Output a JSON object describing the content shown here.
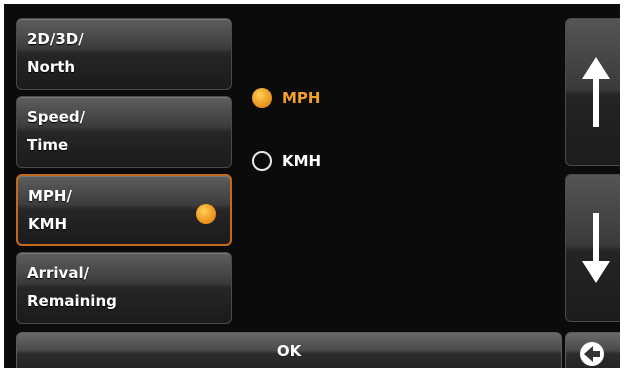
{
  "menu": {
    "items": [
      {
        "line1": "2D/3D/",
        "line2": "North",
        "selected": false
      },
      {
        "line1": "Speed/",
        "line2": "Time",
        "selected": false
      },
      {
        "line1": "MPH/",
        "line2": "KMH",
        "selected": true
      },
      {
        "line1": "Arrival/",
        "line2": "Remaining",
        "selected": false
      }
    ]
  },
  "options": {
    "mph": {
      "label": "MPH",
      "checked": true
    },
    "kmh": {
      "label": "KMH",
      "checked": false
    }
  },
  "footer": {
    "ok_label": "OK"
  },
  "icons": {
    "scroll_up": "arrow-up-icon",
    "scroll_down": "arrow-down-icon",
    "back": "back-icon"
  },
  "colors": {
    "accent": "#f2a42a",
    "selected_border": "#c26a1a",
    "background": "#0b0b0b"
  }
}
